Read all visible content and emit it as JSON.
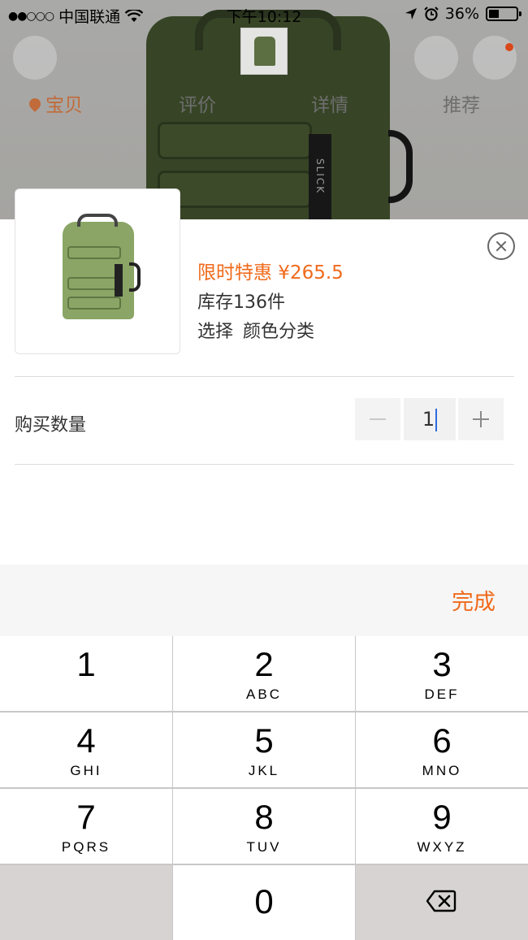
{
  "status_bar": {
    "carrier": "中国联通",
    "time": "下午10:12",
    "battery": "36%",
    "battery_level": 0.36
  },
  "background_page": {
    "tabs": [
      {
        "label": "宝贝",
        "active": true
      },
      {
        "label": "评价",
        "active": false
      },
      {
        "label": "详情",
        "active": false
      },
      {
        "label": "推荐",
        "active": false
      }
    ],
    "bag_tag": "SLICK"
  },
  "sku_sheet": {
    "price_label": "限时特惠 ¥265.5",
    "stock_label": "库存136件",
    "choose_label": "选择",
    "choose_value": "颜色分类",
    "quantity_label": "购买数量",
    "quantity_value": "1"
  },
  "keyboard": {
    "done_label": "完成",
    "keys": [
      {
        "digit": "1",
        "letters": ""
      },
      {
        "digit": "2",
        "letters": "ABC"
      },
      {
        "digit": "3",
        "letters": "DEF"
      },
      {
        "digit": "4",
        "letters": "GHI"
      },
      {
        "digit": "5",
        "letters": "JKL"
      },
      {
        "digit": "6",
        "letters": "MNO"
      },
      {
        "digit": "7",
        "letters": "PQRS"
      },
      {
        "digit": "8",
        "letters": "TUV"
      },
      {
        "digit": "9",
        "letters": "WXYZ"
      },
      {
        "digit": "0",
        "letters": ""
      }
    ]
  },
  "colors": {
    "accent_orange": "#f06a1b",
    "tab_active": "#c16b3a",
    "caret_blue": "#2b6be0"
  },
  "icons": [
    "location-pin-icon",
    "wifi-icon",
    "location-arrow-icon",
    "alarm-icon",
    "close-icon",
    "minus-icon",
    "plus-icon",
    "backspace-icon"
  ]
}
